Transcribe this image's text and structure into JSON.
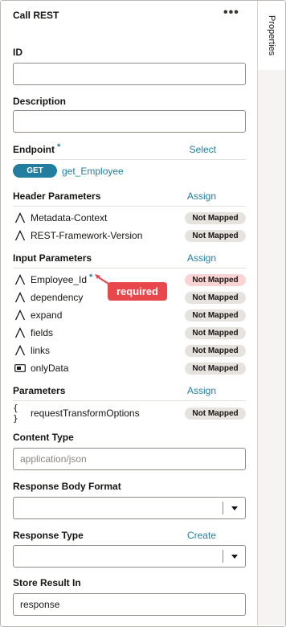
{
  "panel": {
    "title": "Call REST",
    "more_icon": "more-horizontal-icon",
    "more_glyph": "•••"
  },
  "side_tab": {
    "label": "Properties"
  },
  "fields": {
    "id": {
      "label": "ID",
      "value": ""
    },
    "description": {
      "label": "Description",
      "value": ""
    },
    "content_type": {
      "label": "Content Type",
      "placeholder": "application/json"
    },
    "response_body_format": {
      "label": "Response Body Format",
      "value": ""
    },
    "response_type": {
      "label": "Response Type",
      "value": "",
      "link": "Create"
    },
    "store_result_in": {
      "label": "Store Result In",
      "value": "response"
    }
  },
  "endpoint": {
    "label": "Endpoint",
    "required_marker": "*",
    "select_link": "Select",
    "method": "GET",
    "name": "get_Employee"
  },
  "header_parameters": {
    "label": "Header Parameters",
    "assign_link": "Assign",
    "items": [
      {
        "name": "Metadata-Context",
        "icon": "string-type-icon",
        "status": "Not Mapped"
      },
      {
        "name": "REST-Framework-Version",
        "icon": "string-type-icon",
        "status": "Not Mapped"
      }
    ]
  },
  "input_parameters": {
    "label": "Input Parameters",
    "assign_link": "Assign",
    "items": [
      {
        "name": "Employee_Id",
        "icon": "string-type-icon",
        "status": "Not Mapped",
        "required": true,
        "required_marker": "*"
      },
      {
        "name": "dependency",
        "icon": "string-type-icon",
        "status": "Not Mapped"
      },
      {
        "name": "expand",
        "icon": "string-type-icon",
        "status": "Not Mapped"
      },
      {
        "name": "fields",
        "icon": "string-type-icon",
        "status": "Not Mapped"
      },
      {
        "name": "links",
        "icon": "string-type-icon",
        "status": "Not Mapped"
      },
      {
        "name": "onlyData",
        "icon": "boolean-type-icon",
        "status": "Not Mapped"
      }
    ]
  },
  "parameters": {
    "label": "Parameters",
    "assign_link": "Assign",
    "items": [
      {
        "name": "requestTransformOptions",
        "icon": "object-type-icon",
        "status": "Not Mapped"
      }
    ]
  },
  "annotation": {
    "text": "required"
  },
  "colors": {
    "accent": "#227e9e",
    "callout": "#e8474b",
    "badge": "#e6e3df",
    "badge_required": "#fad4d4"
  }
}
